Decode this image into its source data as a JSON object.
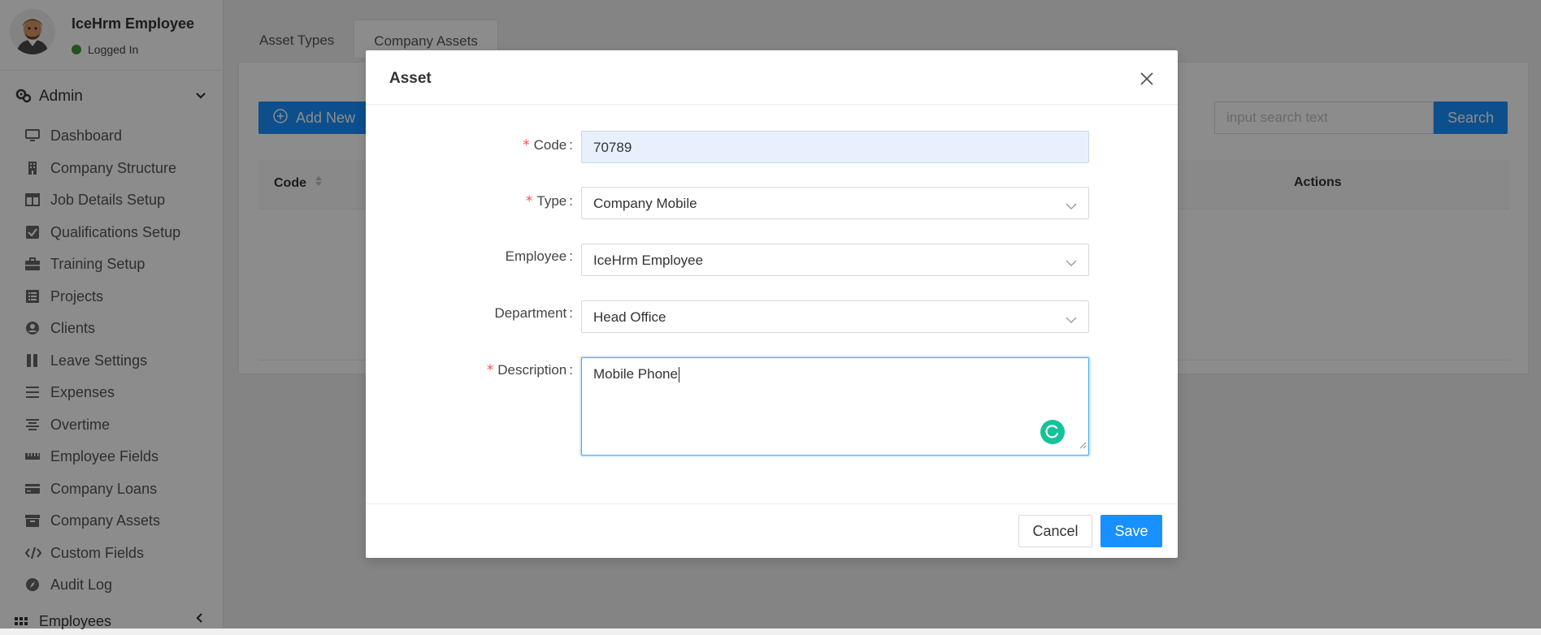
{
  "user": {
    "name": "IceHrm Employee",
    "status": "Logged In"
  },
  "sidebar": {
    "section_label": "Admin",
    "items": [
      {
        "label": "Dashboard",
        "icon": "desktop-icon"
      },
      {
        "label": "Company Structure",
        "icon": "building-icon"
      },
      {
        "label": "Job Details Setup",
        "icon": "columns-icon"
      },
      {
        "label": "Qualifications Setup",
        "icon": "check-square-icon"
      },
      {
        "label": "Training Setup",
        "icon": "briefcase-icon"
      },
      {
        "label": "Projects",
        "icon": "list-alt-icon"
      },
      {
        "label": "Clients",
        "icon": "user-circle-icon"
      },
      {
        "label": "Leave Settings",
        "icon": "pause-icon"
      },
      {
        "label": "Expenses",
        "icon": "bars-icon"
      },
      {
        "label": "Overtime",
        "icon": "align-center-icon"
      },
      {
        "label": "Employee Fields",
        "icon": "ruler-icon"
      },
      {
        "label": "Company Loans",
        "icon": "credit-card-icon"
      },
      {
        "label": "Company Assets",
        "icon": "archive-icon"
      },
      {
        "label": "Custom Fields",
        "icon": "code-icon"
      },
      {
        "label": "Audit Log",
        "icon": "compass-icon"
      }
    ],
    "bottom_section_label": "Employees"
  },
  "tabs": [
    {
      "label": "Asset Types"
    },
    {
      "label": "Company Assets"
    }
  ],
  "toolbar": {
    "add_label": "Add New",
    "search_placeholder": "input search text",
    "search_label": "Search"
  },
  "table": {
    "col_code": "Code",
    "col_actions": "Actions"
  },
  "modal": {
    "title": "Asset",
    "fields": {
      "code": {
        "label": "Code",
        "value": "70789"
      },
      "type": {
        "label": "Type",
        "value": "Company Mobile"
      },
      "employee": {
        "label": "Employee",
        "value": "IceHrm Employee"
      },
      "department": {
        "label": "Department",
        "value": "Head Office"
      },
      "description": {
        "label": "Description",
        "value": "Mobile Phone"
      }
    },
    "cancel_label": "Cancel",
    "save_label": "Save"
  },
  "colors": {
    "primary": "#1890ff",
    "required": "#ff4d4f",
    "status_online": "#3c9a3c",
    "grammarly": "#15c39a"
  }
}
